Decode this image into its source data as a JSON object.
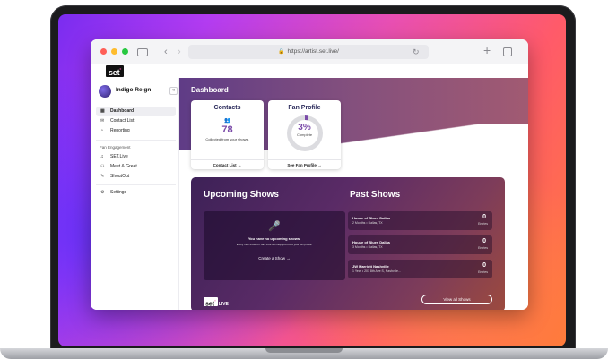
{
  "browser": {
    "url": "https://artist.set.live/",
    "icons": [
      "sidebar-icon",
      "back-icon",
      "forward-icon",
      "lock-icon",
      "reload-icon",
      "new-tab-icon",
      "tab-overview-icon"
    ]
  },
  "app": {
    "logo": "set",
    "logo_mark": "°"
  },
  "sidebar": {
    "profile_name": "Indigo Reign",
    "collapse": "«",
    "items": [
      {
        "label": "Dashboard",
        "icon": "▦",
        "active": true
      },
      {
        "label": "Contact List",
        "icon": "✉"
      },
      {
        "label": "Reporting",
        "icon": "◔"
      }
    ],
    "section_label": "Fan Engagement",
    "engagement_items": [
      {
        "label": "SET.Live",
        "icon": "♫"
      },
      {
        "label": "Meet & Greet",
        "icon": "⚇"
      },
      {
        "label": "ShoutOut",
        "icon": "✎"
      }
    ],
    "settings_label": "Settings",
    "settings_icon": "⚙"
  },
  "dashboard": {
    "title": "Dashboard",
    "contacts": {
      "title": "Contacts",
      "icon": "👥",
      "count": "78",
      "subtitle": "Collected from your shows.",
      "link": "Contact List →"
    },
    "fan_profile": {
      "title": "Fan Profile",
      "percent": "3%",
      "percent_value": 0.03,
      "label": "Complete",
      "link": "See Fan Profile →"
    }
  },
  "shows": {
    "upcoming_title": "Upcoming Shows",
    "past_title": "Past Shows",
    "empty_title": "You have no upcoming shows.",
    "empty_sub": "Every new show on SET.Live will help you build your fan profile.",
    "create_button": "Create a Show →",
    "past": [
      {
        "name": "House of Blues Dallas",
        "meta": "2 Months • Dallas, TX",
        "count": "0",
        "unit": "Entries"
      },
      {
        "name": "House of Blues Dallas",
        "meta": "3 Months • Dallas, TX",
        "count": "0",
        "unit": "Entries"
      },
      {
        "name": "JW Marriott Nashville",
        "meta": "1 Year • 201 8th Ave S, Nashville...",
        "count": "0",
        "unit": "Entries"
      }
    ],
    "live_logo": "set",
    "live_suffix": "LIVE",
    "view_all": "View all Shows"
  },
  "colors": {
    "accent": "#7a4aa8",
    "brand_pink": "#e04ea0",
    "panel_dark": "#3d2157"
  }
}
